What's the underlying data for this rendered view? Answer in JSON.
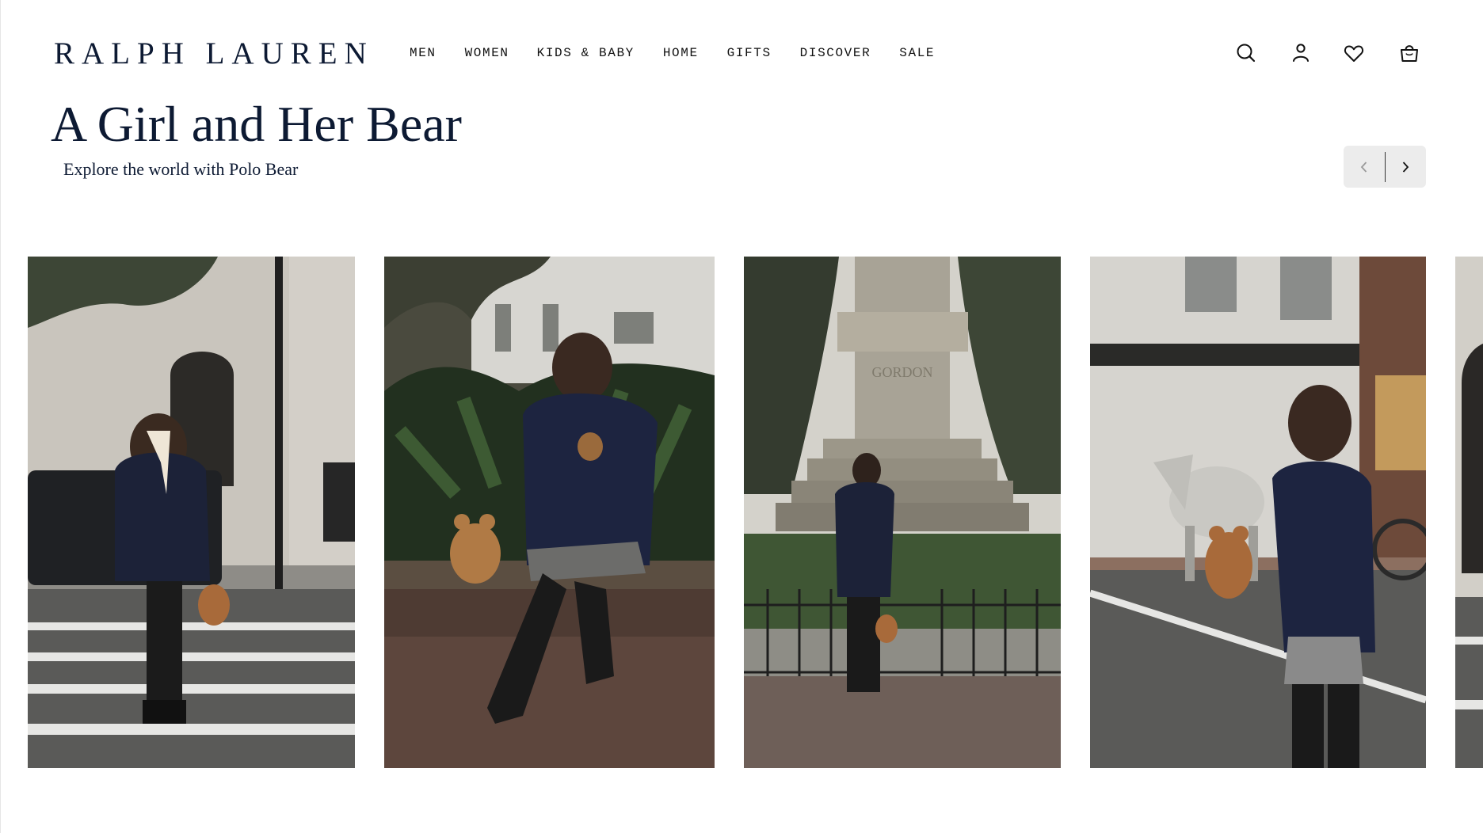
{
  "header": {
    "logo": "RALPH LAUREN",
    "nav": [
      {
        "label": "MEN"
      },
      {
        "label": "WOMEN"
      },
      {
        "label": "KIDS & BABY"
      },
      {
        "label": "HOME"
      },
      {
        "label": "GIFTS"
      },
      {
        "label": "DISCOVER"
      },
      {
        "label": "SALE"
      }
    ],
    "icons": [
      "search-icon",
      "account-icon",
      "wishlist-icon",
      "bag-icon"
    ]
  },
  "hero": {
    "title": "A Girl and Her Bear",
    "subtitle": "Explore the world with Polo Bear"
  },
  "carousel": {
    "prev_icon": "chevron-left-icon",
    "next_icon": "chevron-right-icon",
    "prev_enabled": false,
    "next_enabled": true
  },
  "slides": [
    {
      "scene": "crosswalk-church"
    },
    {
      "scene": "bench-garden"
    },
    {
      "scene": "monument",
      "inscription": "GORDON"
    },
    {
      "scene": "street-carriage"
    },
    {
      "scene": "partial-next"
    }
  ],
  "colors": {
    "brand_navy": "#0d1a33",
    "control_bg": "#ececec",
    "page_bg": "#ffffff"
  }
}
